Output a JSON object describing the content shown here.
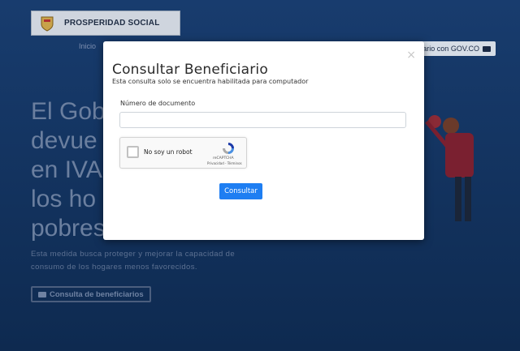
{
  "background": {
    "logo_text": "PROSPERIDAD SOCIAL",
    "nav_inicio": "Inicio",
    "govco_button": "iario con GOV.CO",
    "hero_title": "El Gob\ndevue\nen IVA\nlos ho\npobres",
    "hero_description": "Esta medida busca proteger y mejorar la capacidad de consumo de los hogares menos favorecidos.",
    "hero_button": "Consulta de beneficiarios"
  },
  "modal": {
    "close_glyph": "×",
    "title": "Consultar Beneficiario",
    "subtitle": "Esta consulta solo se encuentra habilitada para computador",
    "document_label": "Número de documento",
    "document_value": "",
    "document_placeholder": "",
    "recaptcha": {
      "label": "No soy un robot",
      "brand": "reCAPTCHA",
      "links": "Privacidad - Términos"
    },
    "submit_label": "Consultar"
  },
  "colors": {
    "background": "#0f2b52",
    "accent": "#1e7ef2"
  }
}
